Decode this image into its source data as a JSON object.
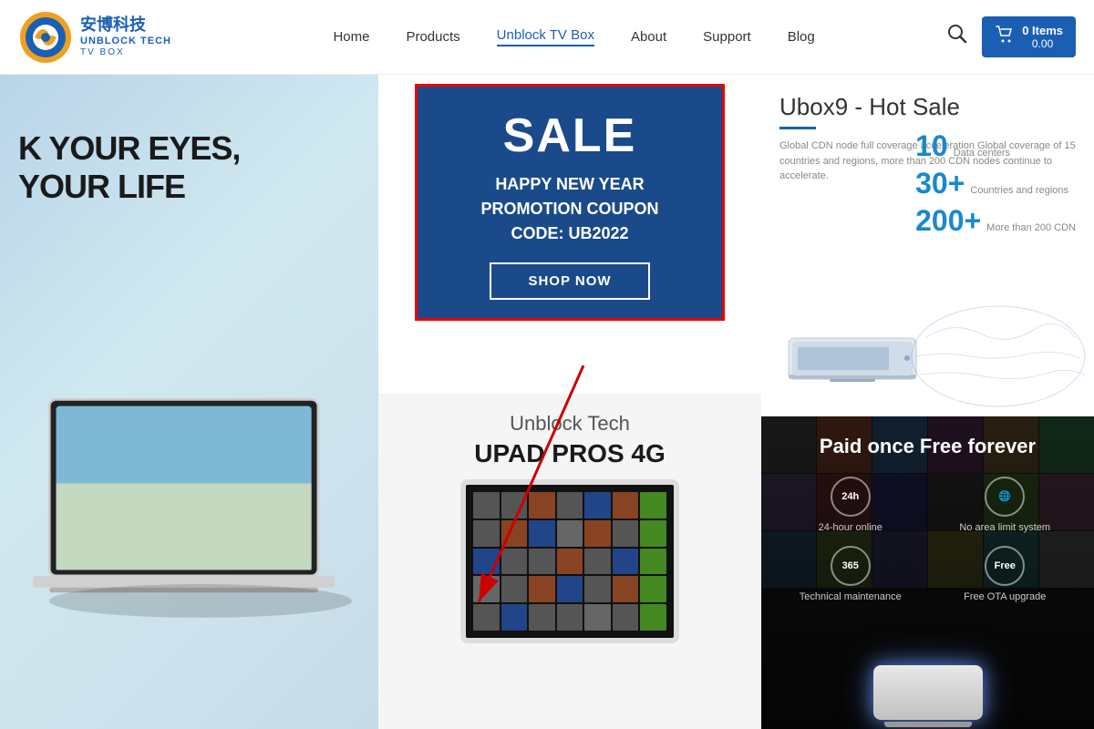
{
  "header": {
    "logo_cn": "安博科技",
    "logo_en": "UNBLOCK TECH",
    "logo_sub": "TV BOX",
    "nav": {
      "items": [
        {
          "label": "Home",
          "id": "home",
          "active": false
        },
        {
          "label": "Products",
          "id": "products",
          "active": false
        },
        {
          "label": "Unblock TV Box",
          "id": "unblock-tv-box",
          "active": false
        },
        {
          "label": "About",
          "id": "about",
          "active": false
        },
        {
          "label": "Support",
          "id": "support",
          "active": false
        },
        {
          "label": "Blog",
          "id": "blog",
          "active": false
        }
      ]
    },
    "cart": {
      "items_label": "0 Items",
      "price_label": "0.00"
    }
  },
  "hero": {
    "line1": "K YOUR EYES,",
    "line2": "YOUR LIFE"
  },
  "sale_banner": {
    "title": "SALE",
    "subtitle_line1": "HAPPY NEW YEAR",
    "subtitle_line2": "PROMOTION COUPON",
    "subtitle_line3": "CODE: UB2022",
    "button_label": "SHOP NOW"
  },
  "product_section": {
    "brand": "Unblock Tech",
    "name": "UPAD PROS 4G"
  },
  "ubox9": {
    "title": "Ubox9 - Hot Sale",
    "description": "Global CDN node full coverage acceleration Global coverage of 15 countries and regions, more than 200 CDN nodes continue to accelerate.",
    "stat1_num": "10",
    "stat1_label": "Data centers",
    "stat2_num": "30+",
    "stat2_label": "Countries and regions",
    "stat3_num": "200+",
    "stat3_label": "More than 200 CDN"
  },
  "paid_once": {
    "title": "Paid once  Free forever",
    "features": [
      {
        "icon": "24h",
        "label": "24-hour online"
      },
      {
        "icon": "🌐",
        "label": "No area limit system"
      },
      {
        "icon": "365",
        "label": "Technical maintenance"
      },
      {
        "icon": "Free",
        "label": "Free OTA upgrade"
      }
    ]
  }
}
